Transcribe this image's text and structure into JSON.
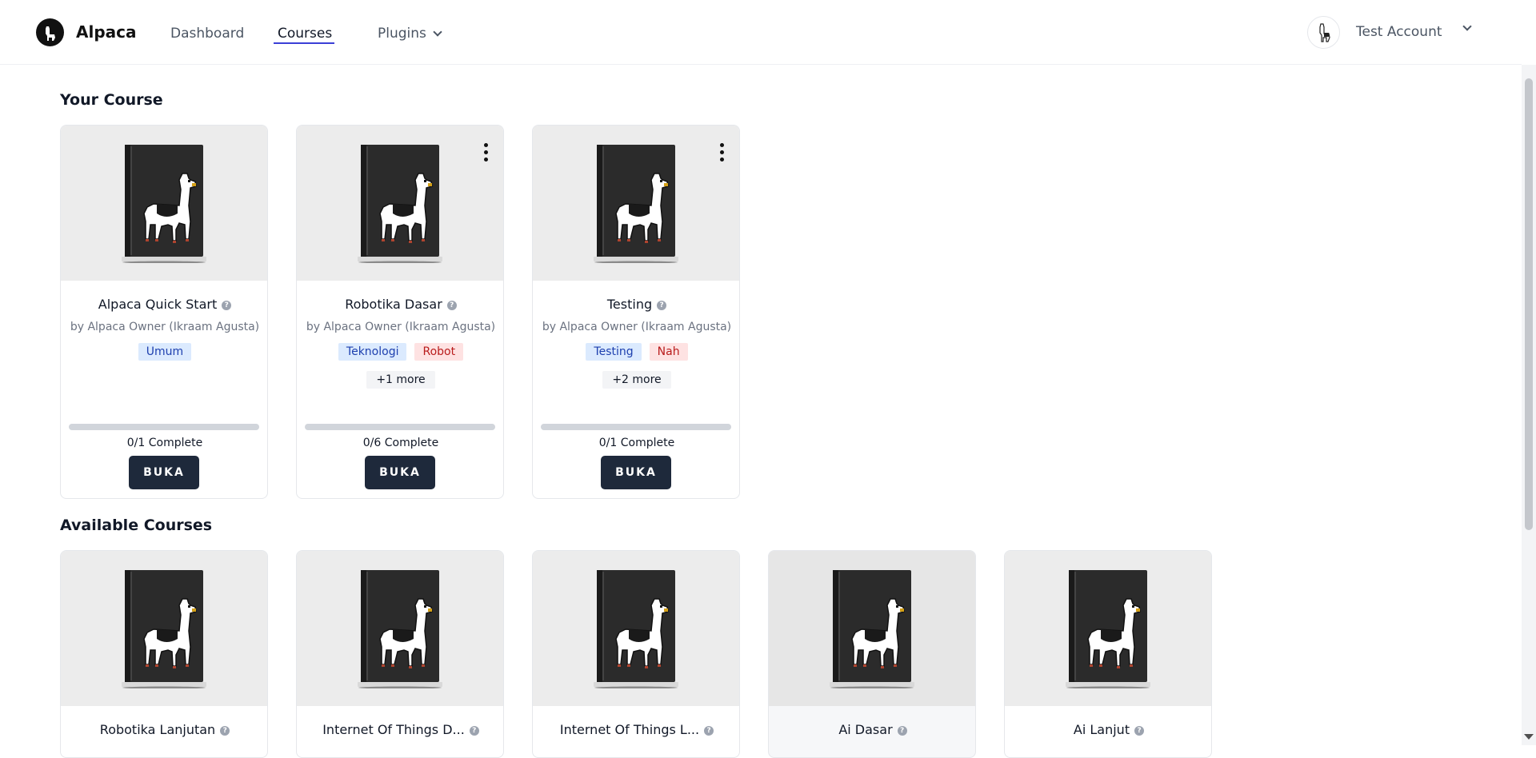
{
  "app": {
    "name": "Alpaca"
  },
  "nav": {
    "dashboard": "Dashboard",
    "courses": "Courses",
    "plugins": "Plugins"
  },
  "account": {
    "name": "Test Account"
  },
  "sections": {
    "your_course": "Your Course",
    "available": "Available Courses"
  },
  "your_courses": [
    {
      "title": "Alpaca Quick Start",
      "author": "by Alpaca Owner (Ikraam Agusta)",
      "tags": [
        {
          "label": "Umum",
          "color": "blue"
        }
      ],
      "more": "",
      "progress": 0,
      "complete": "0/1 Complete",
      "button": "BUKA",
      "menu": false
    },
    {
      "title": "Robotika Dasar",
      "author": "by Alpaca Owner (Ikraam Agusta)",
      "tags": [
        {
          "label": "Teknologi",
          "color": "blue"
        },
        {
          "label": "Robot",
          "color": "red"
        }
      ],
      "more": "+1 more",
      "progress": 0,
      "complete": "0/6 Complete",
      "button": "BUKA",
      "menu": true
    },
    {
      "title": "Testing",
      "author": "by Alpaca Owner (Ikraam Agusta)",
      "tags": [
        {
          "label": "Testing",
          "color": "blue"
        },
        {
          "label": "Nah",
          "color": "red"
        }
      ],
      "more": "+2 more",
      "progress": 0,
      "complete": "0/1 Complete",
      "button": "BUKA",
      "menu": true
    }
  ],
  "available_courses": [
    {
      "title": "Robotika Lanjutan"
    },
    {
      "title": "Internet Of Things D..."
    },
    {
      "title": "Internet Of Things L..."
    },
    {
      "title": "Ai Dasar"
    },
    {
      "title": "Ai Lanjut"
    }
  ],
  "icons": {
    "logo": "alpaca-logo-icon",
    "help": "help-circle-icon",
    "chevron": "chevron-down-icon",
    "menu": "more-vertical-icon"
  },
  "colors": {
    "accent": "#3b3fd6",
    "button": "#1e293b",
    "tag_blue_bg": "#dbeafe",
    "tag_red_bg": "#fee2e2"
  }
}
